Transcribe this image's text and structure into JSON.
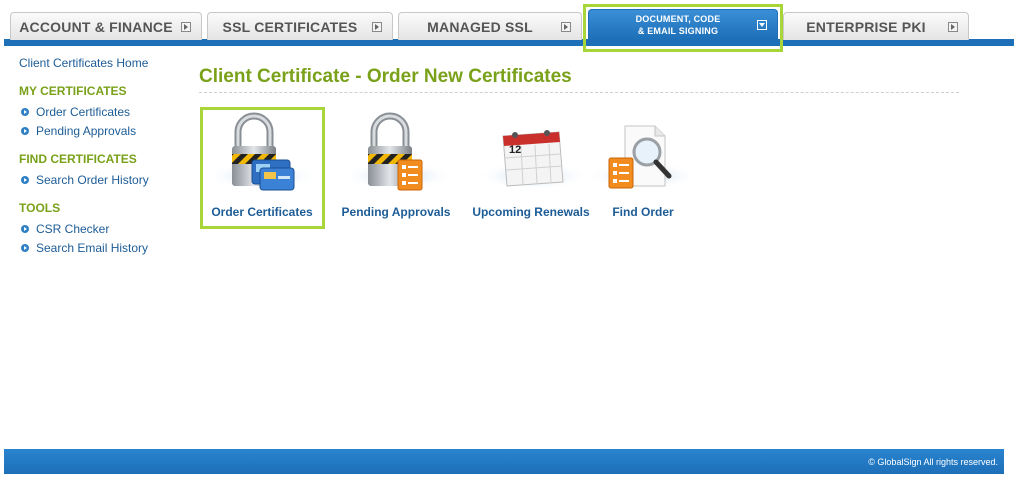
{
  "tabs": [
    {
      "label": "ACCOUNT & FINANCE"
    },
    {
      "label": "SSL CERTIFICATES"
    },
    {
      "label": "MANAGED SSL"
    },
    {
      "label_line1": "DOCUMENT, CODE",
      "label_line2": "& EMAIL SIGNING",
      "active": true
    },
    {
      "label": "ENTERPRISE PKI"
    }
  ],
  "sidebar": {
    "home": "Client Certificates Home",
    "groups": [
      {
        "heading": "MY CERTIFICATES",
        "items": [
          "Order Certificates",
          "Pending Approvals"
        ]
      },
      {
        "heading": "FIND CERTIFICATES",
        "items": [
          "Search Order History"
        ]
      },
      {
        "heading": "TOOLS",
        "items": [
          "CSR Checker",
          "Search Email History"
        ]
      }
    ]
  },
  "main": {
    "title": "Client Certificate - Order New Certificates",
    "tiles": [
      {
        "label": "Order Certificates",
        "icon": "padlock-cards-icon"
      },
      {
        "label": "Pending Approvals",
        "icon": "padlock-checklist-icon"
      },
      {
        "label": "Upcoming Renewals",
        "icon": "calendar-icon",
        "calendar_day": "12"
      },
      {
        "label": "Find Order",
        "icon": "document-magnifier-icon"
      }
    ]
  },
  "footer": {
    "copyright": "© GlobalSign All rights reserved."
  },
  "colors": {
    "accent_blue": "#1d6fb8",
    "title_green": "#7aa11a",
    "link_blue": "#1d5c96",
    "highlight": "#a8d63a"
  }
}
